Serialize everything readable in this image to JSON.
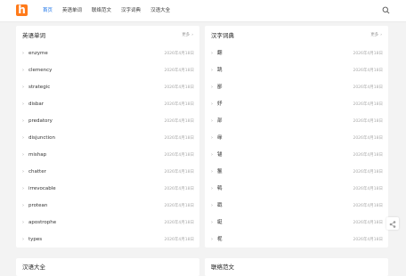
{
  "brand": {
    "logo_letter": "h",
    "accent": "#ff7a1a"
  },
  "nav": {
    "items": [
      {
        "label": "首页",
        "active": true
      },
      {
        "label": "英语单词"
      },
      {
        "label": "联络范文"
      },
      {
        "label": "汉字词典"
      },
      {
        "label": "汉语大全"
      }
    ]
  },
  "sections": {
    "english": {
      "title": "英语单词",
      "more": "更多",
      "items": [
        {
          "word": "enzyme",
          "date": "2026年4月18日"
        },
        {
          "word": "clemency",
          "date": "2026年4月18日"
        },
        {
          "word": "strategic",
          "date": "2026年4月18日"
        },
        {
          "word": "disbar",
          "date": "2026年4月18日"
        },
        {
          "word": "predatory",
          "date": "2026年4月18日"
        },
        {
          "word": "disjunction",
          "date": "2026年4月18日"
        },
        {
          "word": "mishap",
          "date": "2026年4月18日"
        },
        {
          "word": "chatter",
          "date": "2026年4月18日"
        },
        {
          "word": "irrevocable",
          "date": "2026年4月18日"
        },
        {
          "word": "protean",
          "date": "2026年4月18日"
        },
        {
          "word": "apostrophe",
          "date": "2026年4月18日"
        },
        {
          "word": "types",
          "date": "2026年4月18日"
        }
      ]
    },
    "chinese": {
      "title": "汉字词典",
      "more": "更多",
      "items": [
        {
          "word": "翻",
          "date": "2026年4月18日"
        },
        {
          "word": "跳",
          "date": "2026年4月18日"
        },
        {
          "word": "鄙",
          "date": "2026年4月18日"
        },
        {
          "word": "妤",
          "date": "2026年4月18日"
        },
        {
          "word": "部",
          "date": "2026年4月18日"
        },
        {
          "word": "缘",
          "date": "2026年4月18日"
        },
        {
          "word": "锚",
          "date": "2026年4月18日"
        },
        {
          "word": "鬣",
          "date": "2026年4月18日"
        },
        {
          "word": "鹌",
          "date": "2026年4月18日"
        },
        {
          "word": "戳",
          "date": "2026年4月18日"
        },
        {
          "word": "綎",
          "date": "2026年4月18日"
        },
        {
          "word": "柅",
          "date": "2026年4月18日"
        }
      ]
    },
    "bottom": {
      "left_title": "汉语大全",
      "right_title": "联络范文"
    }
  },
  "icons": {
    "search": "search-icon",
    "share": "share-icon",
    "more_chevron": "chevron-right-icon",
    "bullet": "chevron-right-icon"
  }
}
